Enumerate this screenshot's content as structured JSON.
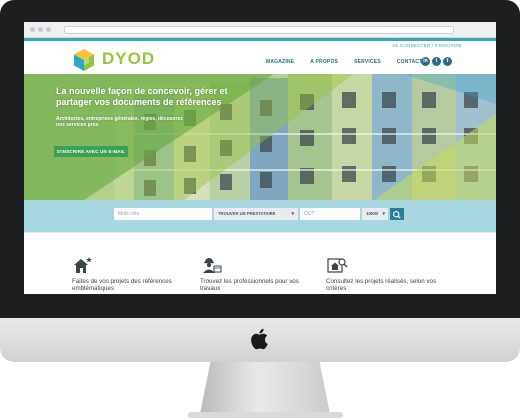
{
  "site": {
    "top_link": "SE CONNECTER / S'INSCRIRE",
    "logo_text": "DYOD"
  },
  "nav": [
    {
      "label": "MAGAZINE"
    },
    {
      "label": "A PROPOS"
    },
    {
      "label": "SERVICES"
    },
    {
      "label": "CONTACT"
    }
  ],
  "socials": [
    {
      "label": "in",
      "icon": "linkedin-icon"
    },
    {
      "label": "t",
      "icon": "twitter-icon"
    },
    {
      "label": "f",
      "icon": "facebook-icon"
    }
  ],
  "hero": {
    "title": "La nouvelle façon de concevoir, gérer et partager vos documents de références",
    "subtitle": "Architectes, entreprises générales, régies, découvrez nos services pros",
    "cta": "S'INSCRIRE AVEC UN E-MAIL"
  },
  "search": {
    "keyword_placeholder": "Mots clés",
    "provider_select": "TROUVER UN PRESTATAIRE",
    "where_placeholder": "OU?",
    "radius_select": "10KM"
  },
  "features": [
    {
      "text": "Faites de vos projets des références emblématiques",
      "icon": "house-star-icon"
    },
    {
      "text": "Trouvez les professionnels pour vos travaux",
      "icon": "worker-icon"
    },
    {
      "text": "Consultez les projets réalisés, selon vos critères",
      "icon": "search-house-icon"
    }
  ],
  "colors": {
    "accent_teal": "#37a6b5",
    "nav_blue": "#2a6d8a",
    "brand_green": "#9bc43c",
    "cta_green": "#3aa152",
    "search_band": "#a7d7e1"
  }
}
